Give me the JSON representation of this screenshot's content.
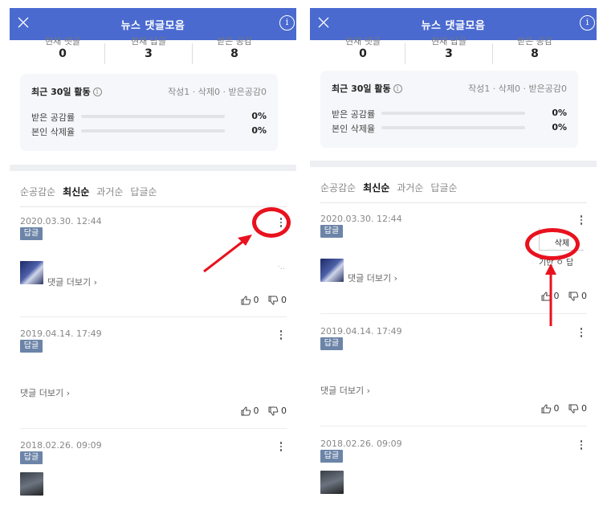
{
  "app": {
    "title": "뉴스 댓글모음",
    "info_symbol": "i"
  },
  "stats": [
    {
      "label": "현재 댓글",
      "value": "0"
    },
    {
      "label": "현재 답글",
      "value": "3"
    },
    {
      "label": "받은 공감",
      "value": "8"
    }
  ],
  "activity": {
    "title": "최근 30일 활동",
    "summary": "작성1 · 삭제0 · 받은공감0",
    "rows": [
      {
        "label": "받은 공감률",
        "value": "0%",
        "fraction": 0
      },
      {
        "label": "본인 삭제율",
        "value": "0%",
        "fraction": 0
      }
    ]
  },
  "sort_tabs": [
    {
      "label": "순공감순",
      "active": false
    },
    {
      "label": "최신순",
      "active": true
    },
    {
      "label": "과거순",
      "active": false
    },
    {
      "label": "답글순",
      "active": false
    }
  ],
  "comments": [
    {
      "date": "2020.03.30. 12:44",
      "badge": "답글",
      "more_link": "댓글 더보기 ›",
      "likes": "0",
      "dislikes": "0"
    },
    {
      "date": "2019.04.14. 17:49",
      "badge": "답글",
      "more_link": "댓글 더보기 ›",
      "likes": "0",
      "dislikes": "0"
    },
    {
      "date": "2018.02.26. 09:09",
      "badge": "답글"
    }
  ],
  "popup": {
    "delete_label": "삭제",
    "partial_text": "·..",
    "partial_text_2": "기반 ㅇ 답"
  },
  "annotation": {
    "color": "#e8121e"
  }
}
